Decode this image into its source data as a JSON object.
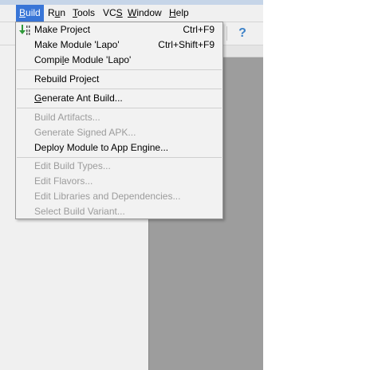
{
  "menubar": {
    "items": [
      {
        "prefix": "",
        "u": "B",
        "rest": "uild",
        "active": true
      },
      {
        "prefix": "R",
        "u": "u",
        "rest": "n",
        "active": false
      },
      {
        "prefix": "",
        "u": "T",
        "rest": "ools",
        "active": false
      },
      {
        "prefix": "VC",
        "u": "S",
        "rest": "",
        "active": false
      },
      {
        "prefix": "",
        "u": "W",
        "rest": "indow",
        "active": false
      },
      {
        "prefix": "",
        "u": "H",
        "rest": "elp",
        "active": false
      }
    ]
  },
  "toolbar": {
    "help_symbol": "?"
  },
  "build_menu": {
    "items": [
      {
        "label": "Make Project",
        "shortcut": "Ctrl+F9",
        "enabled": true,
        "icon": "make-project-icon"
      },
      {
        "label": "Make Module 'Lapo'",
        "shortcut": "Ctrl+Shift+F9",
        "enabled": true
      },
      {
        "label_pre": "Compi",
        "label_u": "l",
        "label_post": "e Module 'Lapo'",
        "shortcut": "",
        "enabled": true
      },
      {
        "label": "Rebuild Project",
        "shortcut": "",
        "enabled": true
      },
      {
        "label_pre": "",
        "label_u": "G",
        "label_post": "enerate Ant Build...",
        "shortcut": "",
        "enabled": true
      },
      {
        "label": "Build Artifacts...",
        "shortcut": "",
        "enabled": false
      },
      {
        "label": "Generate Signed APK...",
        "shortcut": "",
        "enabled": false
      },
      {
        "label": "Deploy Module to App Engine...",
        "shortcut": "",
        "enabled": true
      },
      {
        "label": "Edit Build Types...",
        "shortcut": "",
        "enabled": false
      },
      {
        "label": "Edit Flavors...",
        "shortcut": "",
        "enabled": false
      },
      {
        "label": "Edit Libraries and Dependencies...",
        "shortcut": "",
        "enabled": false
      },
      {
        "label": "Select Build Variant...",
        "shortcut": "",
        "enabled": false
      }
    ]
  },
  "colors": {
    "menu_highlight": "#3875d7",
    "disabled_text": "#9c9c9c",
    "editor_gray": "#9d9d9d",
    "icon_green": "#2f9a3a"
  }
}
